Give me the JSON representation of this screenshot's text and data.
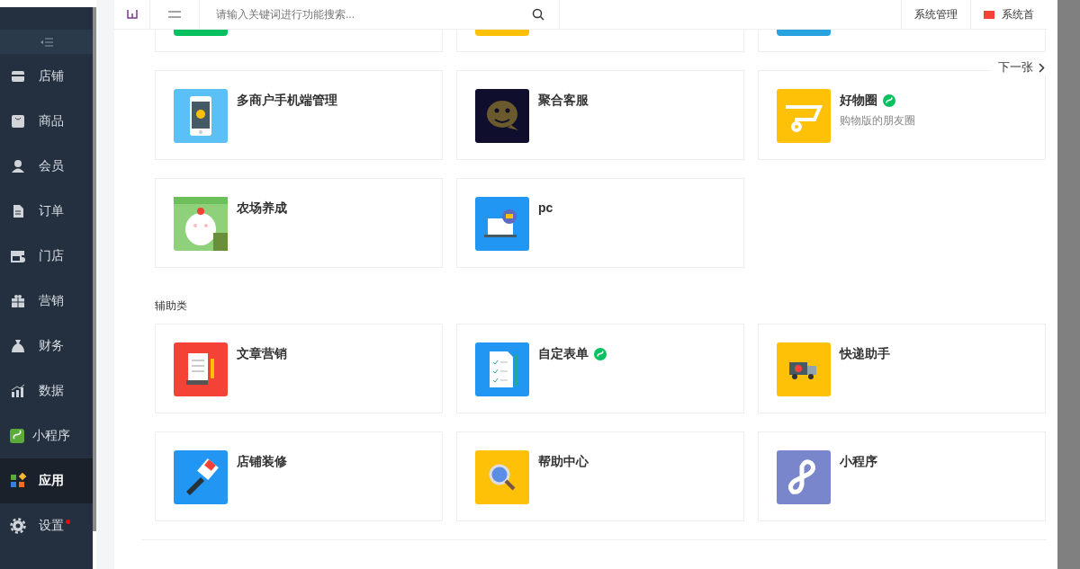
{
  "header": {
    "search": {
      "placeholder": "请输入关键词进行功能搜索..."
    },
    "links": [
      {
        "label": "系统管理",
        "kind": "text"
      },
      {
        "label": "系统首",
        "kind": "flag"
      }
    ]
  },
  "sidebar": {
    "items": [
      {
        "label": "店铺",
        "kind": "store",
        "selected": false,
        "dot": false
      },
      {
        "label": "商品",
        "kind": "bag",
        "selected": false,
        "dot": false
      },
      {
        "label": "会员",
        "kind": "user",
        "selected": false,
        "dot": false
      },
      {
        "label": "订单",
        "kind": "doc",
        "selected": false,
        "dot": false
      },
      {
        "label": "门店",
        "kind": "shop",
        "selected": false,
        "dot": false
      },
      {
        "label": "营销",
        "kind": "gift",
        "selected": false,
        "dot": false
      },
      {
        "label": "财务",
        "kind": "money",
        "selected": false,
        "dot": false
      },
      {
        "label": "数据",
        "kind": "chart",
        "selected": false,
        "dot": false
      },
      {
        "label": "小程序",
        "kind": "mini",
        "selected": false,
        "dot": false
      },
      {
        "label": "应用",
        "kind": "apps",
        "selected": true,
        "dot": false
      },
      {
        "label": "设置",
        "kind": "gear",
        "selected": false,
        "dot": true
      }
    ]
  },
  "cut_cards": [
    {
      "color": "#07c160"
    },
    {
      "color": "#ffc107"
    },
    {
      "color": "#29a3e0"
    }
  ],
  "carousel": {
    "next": "下一张"
  },
  "sections": [
    {
      "cards": [
        {
          "title": "多商户手机端管理",
          "kind": "phone",
          "mini_program": false
        },
        {
          "title": "聚合客服",
          "kind": "chat",
          "mini_program": false
        },
        {
          "title": "好物圈",
          "subtitle": "购物版的朋友圈",
          "kind": "cart",
          "mini_program": true
        },
        {
          "title": "农场养成",
          "kind": "chick",
          "mini_program": false
        },
        {
          "title": "pc",
          "kind": "laptop",
          "mini_program": false
        }
      ]
    },
    {
      "title": "辅助类",
      "cards": [
        {
          "title": "文章营销",
          "kind": "scroll",
          "mini_program": false
        },
        {
          "title": "自定表单",
          "kind": "form",
          "mini_program": true
        },
        {
          "title": "快递助手",
          "kind": "truck",
          "mini_program": false
        },
        {
          "title": "店铺装修",
          "kind": "brush",
          "mini_program": false
        },
        {
          "title": "帮助中心",
          "kind": "search",
          "mini_program": false
        },
        {
          "title": "小程序",
          "kind": "link",
          "mini_program": false
        }
      ]
    }
  ]
}
